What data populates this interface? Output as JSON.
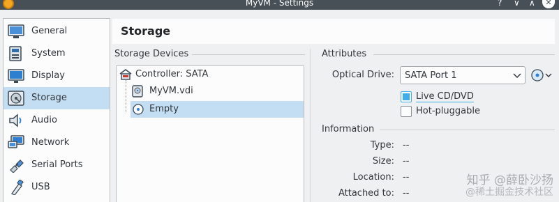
{
  "window": {
    "title": "MyVM - Settings",
    "help_glyph": "?",
    "minimize_glyph": "∨",
    "maximize_glyph": "∧",
    "close_glyph": "✕"
  },
  "sidebar": {
    "items": [
      {
        "label": "General",
        "icon": "general-icon",
        "active": false
      },
      {
        "label": "System",
        "icon": "system-icon",
        "active": false
      },
      {
        "label": "Display",
        "icon": "display-icon",
        "active": false
      },
      {
        "label": "Storage",
        "icon": "storage-icon",
        "active": true
      },
      {
        "label": "Audio",
        "icon": "audio-icon",
        "active": false
      },
      {
        "label": "Network",
        "icon": "network-icon",
        "active": false
      },
      {
        "label": "Serial Ports",
        "icon": "serial-ports-icon",
        "active": false
      },
      {
        "label": "USB",
        "icon": "usb-icon",
        "active": false
      }
    ]
  },
  "page": {
    "title": "Storage"
  },
  "storage_devices": {
    "label": "Storage Devices",
    "tree": [
      {
        "label": "Controller: SATA",
        "icon": "controller-icon",
        "level": 0,
        "selected": false
      },
      {
        "label": "MyVM.vdi",
        "icon": "hard-disk-icon",
        "level": 1,
        "selected": false
      },
      {
        "label": "Empty",
        "icon": "optical-disc-icon",
        "level": 1,
        "selected": true
      }
    ]
  },
  "attributes": {
    "label": "Attributes",
    "optical_drive_label": "Optical Drive:",
    "optical_drive_value": "SATA Port 1",
    "live_cd_label": "Live CD/DVD",
    "live_cd_checked": true,
    "hot_pluggable_label": "Hot-pluggable",
    "hot_pluggable_checked": false
  },
  "information": {
    "label": "Information",
    "rows": [
      {
        "label": "Type:",
        "value": "--"
      },
      {
        "label": "Size:",
        "value": "--"
      },
      {
        "label": "Location:",
        "value": "--"
      },
      {
        "label": "Attached to:",
        "value": "--"
      }
    ]
  },
  "watermark": {
    "line1": "知乎 @薛卧沙扬",
    "line2": "@稀土掘金技术社区"
  },
  "colors": {
    "titlebar": "#475057",
    "selection": "#c3ddf3",
    "accent": "#3daee9",
    "background": "#eff0f1"
  }
}
